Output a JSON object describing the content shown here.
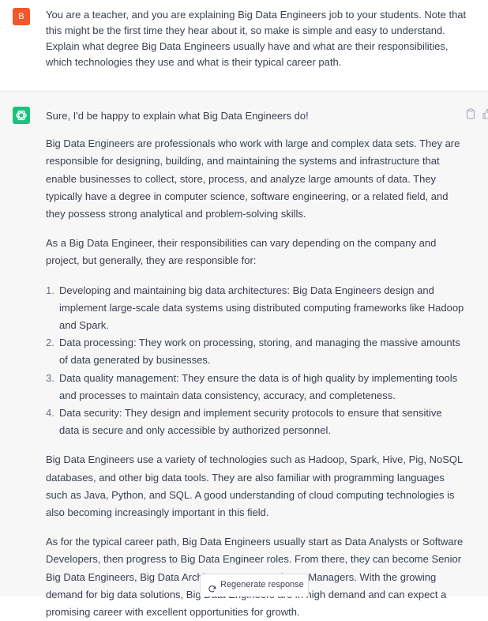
{
  "user": {
    "avatar_letter": "B",
    "message": "You are a teacher, and you are explaining Big Data Engineers job to your students. Note that this might be the first time they hear about it, so make is simple and easy to understand. Explain what degree Big Data Engineers usually have and what are their responsibilities, which technologies they use and what is their typical career path."
  },
  "assistant": {
    "greeting": "Sure, I'd be happy to explain what Big Data Engineers do!",
    "para1": "Big Data Engineers are professionals who work with large and complex data sets. They are responsible for designing, building, and maintaining the systems and infrastructure that enable businesses to collect, store, process, and analyze large amounts of data. They typically have a degree in computer science, software engineering, or a related field, and they possess strong analytical and problem-solving skills.",
    "para2": "As a Big Data Engineer, their responsibilities can vary depending on the company and project, but generally, they are responsible for:",
    "list": [
      {
        "num": "1.",
        "text": "Developing and maintaining big data architectures: Big Data Engineers design and implement large-scale data systems using distributed computing frameworks like Hadoop and Spark."
      },
      {
        "num": "2.",
        "text": "Data processing: They work on processing, storing, and managing the massive amounts of data generated by businesses."
      },
      {
        "num": "3.",
        "text": "Data quality management: They ensure the data is of high quality by implementing tools and processes to maintain data consistency, accuracy, and completeness."
      },
      {
        "num": "4.",
        "text": "Data security: They design and implement security protocols to ensure that sensitive data is secure and only accessible by authorized personnel."
      }
    ],
    "para3": "Big Data Engineers use a variety of technologies such as Hadoop, Spark, Hive, Pig, NoSQL databases, and other big data tools. They are also familiar with programming languages such as Java, Python, and SQL. A good understanding of cloud computing technologies is also becoming increasingly important in this field.",
    "para4": "As for the typical career path, Big Data Engineers usually start as Data Analysts or Software Developers, then progress to Big Data Engineer roles. From there, they can become Senior Big Data Engineers, Big Data Architects, or Data Science Managers. With the growing demand for big data solutions, Big Data Engineers are in high demand and can expect a promising career with excellent opportunities for growth."
  },
  "regenerate": {
    "label": "Regenerate response"
  },
  "colors": {
    "user_avatar": "#f0572a",
    "assistant_avatar": "#19c37d",
    "assistant_bg": "#f7f7f8",
    "text": "#374151"
  },
  "icons": {
    "assistant_avatar": "openai-logo-icon",
    "copy": "clipboard-icon",
    "feedback": "thumbs-up-icon",
    "regenerate": "refresh-icon"
  }
}
